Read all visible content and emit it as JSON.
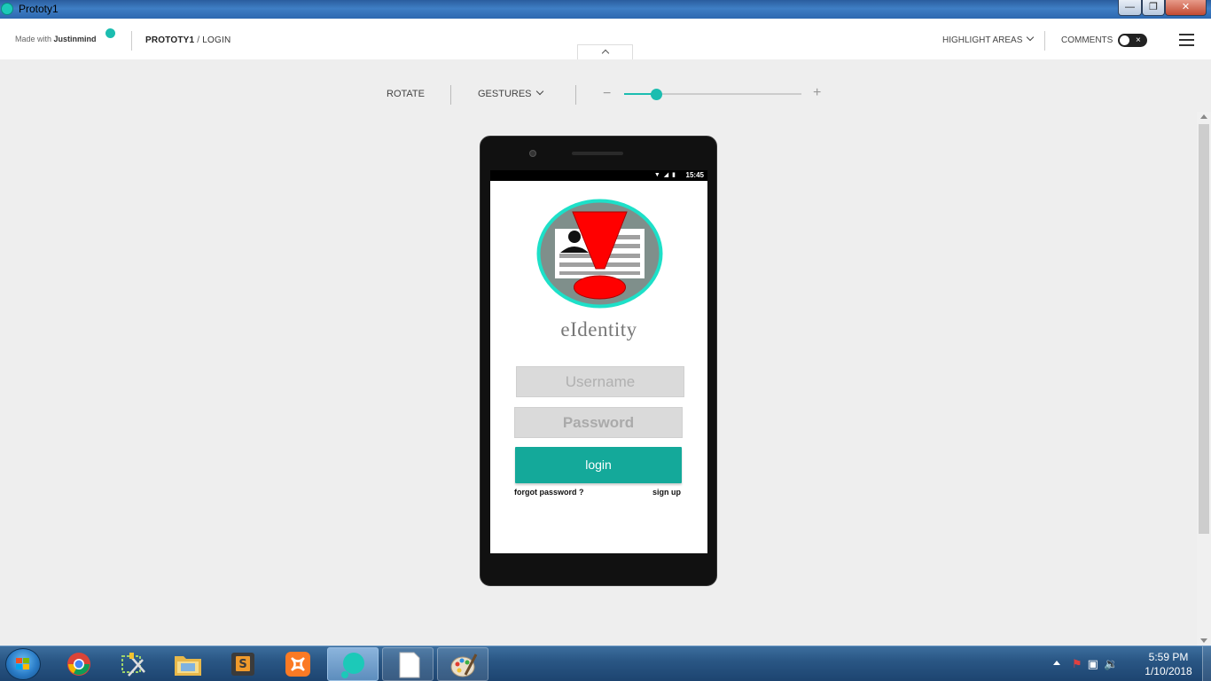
{
  "window": {
    "title": "Prototy1"
  },
  "header": {
    "made_with_prefix": "Made with",
    "made_with_brand": "Justinmind",
    "project": "PROTOTY1",
    "separator": " / ",
    "page": "LOGIN",
    "highlight_label": "HIGHLIGHT AREAS",
    "comments_label": "COMMENTS",
    "comments_toggle_on": false
  },
  "toolbar": {
    "rotate_label": "ROTATE",
    "gestures_label": "GESTURES",
    "zoom_minus": "−",
    "zoom_plus": "+",
    "zoom_level": 0.18
  },
  "phone": {
    "status_time": "15:45",
    "app_name": "eIdentity",
    "username_placeholder": "Username",
    "password_placeholder": "Password",
    "login_label": "login",
    "forgot_label": "forgot password ?",
    "signup_label": "sign up"
  },
  "taskbar": {
    "apps": [
      "chrome-icon",
      "snipping-tool-icon",
      "file-explorer-icon",
      "sublime-text-icon",
      "xampp-icon",
      "justinmind-icon",
      "document-icon",
      "paint-icon"
    ],
    "time": "5:59 PM",
    "date": "1/10/2018"
  },
  "colors": {
    "accent": "#1cbdb0",
    "login_button": "#14a99a",
    "logo_ring": "#1de0c8",
    "logo_alert": "#ff0000"
  }
}
